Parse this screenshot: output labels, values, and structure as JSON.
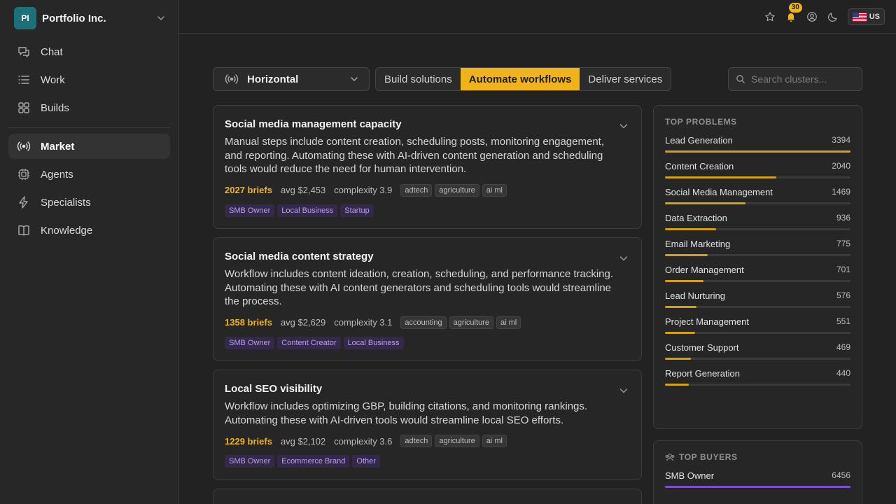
{
  "org": {
    "initials": "PI",
    "name": "Portfolio Inc."
  },
  "nav": {
    "primary": [
      {
        "label": "Chat",
        "icon": "chat-icon"
      },
      {
        "label": "Work",
        "icon": "list-icon"
      },
      {
        "label": "Builds",
        "icon": "grid-icon"
      }
    ],
    "secondary": [
      {
        "label": "Market",
        "icon": "broadcast-icon",
        "active": true
      },
      {
        "label": "Agents",
        "icon": "chip-icon"
      },
      {
        "label": "Specialists",
        "icon": "bolt-icon"
      },
      {
        "label": "Knowledge",
        "icon": "book-icon"
      }
    ]
  },
  "topbar": {
    "notifications": "30",
    "locale": "US"
  },
  "toolbar": {
    "select_value": "Horizontal",
    "segments": [
      "Build solutions",
      "Automate workflows",
      "Deliver services"
    ],
    "active_segment": "Automate workflows",
    "search_placeholder": "Search clusters..."
  },
  "cards": [
    {
      "title": "Social media management capacity",
      "description": "Manual steps include content creation, scheduling posts, monitoring engagement, and reporting. Automating these with AI-driven content generation and scheduling tools would reduce the need for human intervention.",
      "briefs": "2027 briefs",
      "avg": "avg $2,453",
      "complexity": "complexity 3.9",
      "tags": [
        "adtech",
        "agriculture",
        "ai ml"
      ],
      "personas": [
        "SMB Owner",
        "Local Business",
        "Startup"
      ]
    },
    {
      "title": "Social media content strategy",
      "description": "Workflow includes content ideation, creation, scheduling, and performance tracking. Automating these with AI content generators and scheduling tools would streamline the process.",
      "briefs": "1358 briefs",
      "avg": "avg $2,629",
      "complexity": "complexity 3.1",
      "tags": [
        "accounting",
        "agriculture",
        "ai ml"
      ],
      "personas": [
        "SMB Owner",
        "Content Creator",
        "Local Business"
      ]
    },
    {
      "title": "Local SEO visibility",
      "description": "Workflow includes optimizing GBP, building citations, and monitoring rankings. Automating these with AI-driven tools would streamline local SEO efforts.",
      "briefs": "1229 briefs",
      "avg": "avg $2,102",
      "complexity": "complexity 3.6",
      "tags": [
        "adtech",
        "agriculture",
        "ai ml"
      ],
      "personas": [
        "SMB Owner",
        "Ecommerce Brand",
        "Other"
      ]
    }
  ],
  "top_problems": {
    "title": "TOP PROBLEMS",
    "color": "#d4a017",
    "items": [
      {
        "label": "Lead Generation",
        "count": 3394
      },
      {
        "label": "Content Creation",
        "count": 2040
      },
      {
        "label": "Social Media Management",
        "count": 1469
      },
      {
        "label": "Data Extraction",
        "count": 936
      },
      {
        "label": "Email Marketing",
        "count": 775
      },
      {
        "label": "Order Management",
        "count": 701
      },
      {
        "label": "Lead Nurturing",
        "count": 576
      },
      {
        "label": "Project Management",
        "count": 551
      },
      {
        "label": "Customer Support",
        "count": 469
      },
      {
        "label": "Report Generation",
        "count": 440
      }
    ]
  },
  "top_buyers": {
    "title": "TOP BUYERS",
    "color": "#7b4fd0",
    "items": [
      {
        "label": "SMB Owner",
        "count": 6456
      }
    ]
  }
}
